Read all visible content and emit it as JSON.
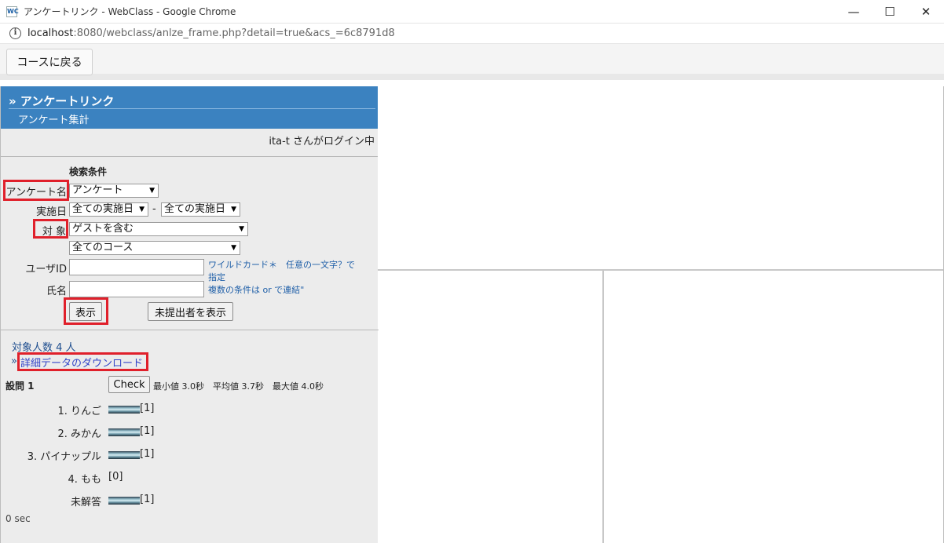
{
  "window": {
    "title": "アンケートリンク - WebClass - Google Chrome",
    "favicon": "WC",
    "minimize": "—",
    "maximize": "☐",
    "close": "✕"
  },
  "urlbar": {
    "host": "localhost",
    "rest": ":8080/webclass/anlze_frame.php?detail=true&acs_=6c8791d8"
  },
  "toolbar": {
    "back_label": "コースに戻る"
  },
  "header": {
    "title": "» アンケートリンク",
    "subtitle": "アンケート集計"
  },
  "login_text": "ita-t さんがログイン中",
  "search": {
    "heading": "検索条件",
    "survey_label": "アンケート名",
    "survey_value": "アンケート",
    "date_label": "実施日",
    "date_from": "全ての実施日",
    "date_sep": "-",
    "date_to": "全ての実施日",
    "target_label": "対 象",
    "target_value": "ゲストを含む",
    "course_value": "全てのコース",
    "userid_label": "ユーザID",
    "name_label": "氏名",
    "hint_line1": "ワイルドカード＊　任意の一文字？で",
    "hint_line2": "指定",
    "hint_line3": "複数の条件は or で連結\"",
    "show_button": "表示",
    "unsubmitted_button": "未提出者を表示"
  },
  "results": {
    "count_text": "対象人数 4 人",
    "download_prefix": "»",
    "download_link": "詳細データのダウンロード",
    "question_title": "設問 1",
    "check_button": "Check",
    "stats": "最小値 3.0秒　平均値 3.7秒　最大値 4.0秒",
    "options": [
      {
        "label": "1. りんご",
        "count": "[1]",
        "value": 1
      },
      {
        "label": "2. みかん",
        "count": "[1]",
        "value": 1
      },
      {
        "label": "3. パイナップル",
        "count": "[1]",
        "value": 1
      },
      {
        "label": "4. もも",
        "count": "[0]",
        "value": 0
      },
      {
        "label": "未解答",
        "count": "[1]",
        "value": 1
      }
    ],
    "elapsed": "0 sec"
  },
  "colors": {
    "header_bg": "#3b82c0",
    "highlight_box": "#e0202b",
    "link": "#3344c8"
  }
}
